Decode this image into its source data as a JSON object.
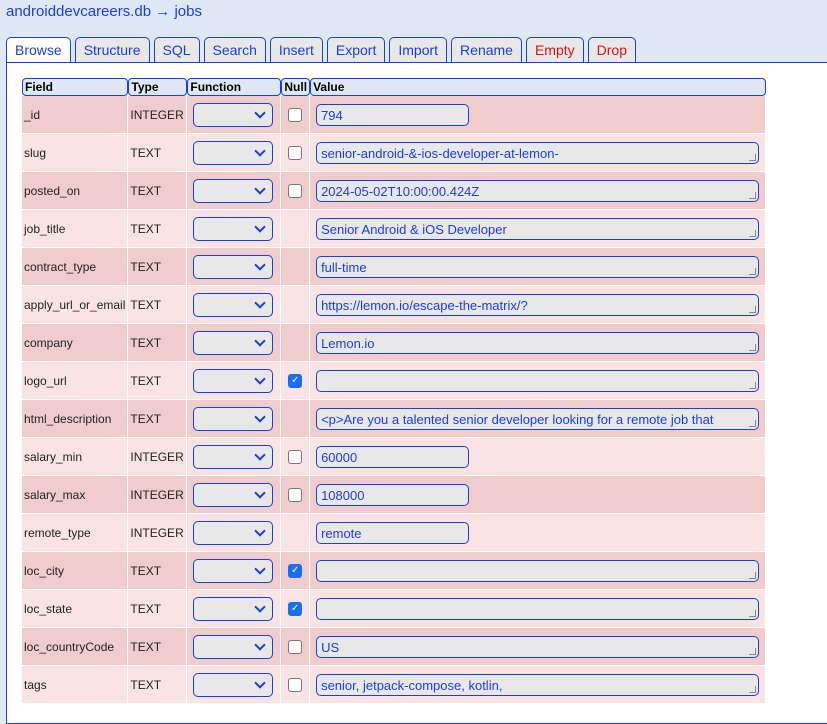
{
  "breadcrumb": {
    "db": "androiddevcareers.db",
    "arrow": "→",
    "table": "jobs"
  },
  "tabs": [
    {
      "label": "Browse",
      "active": true
    },
    {
      "label": "Structure"
    },
    {
      "label": "SQL"
    },
    {
      "label": "Search"
    },
    {
      "label": "Insert"
    },
    {
      "label": "Export"
    },
    {
      "label": "Import"
    },
    {
      "label": "Rename"
    },
    {
      "label": "Empty",
      "danger": true
    },
    {
      "label": "Drop",
      "danger": true
    }
  ],
  "headers": {
    "field": "Field",
    "type": "Type",
    "function": "Function",
    "null": "Null",
    "value": "Value"
  },
  "rows": [
    {
      "field": "_id",
      "type": "INTEGER",
      "nullable": true,
      "null": false,
      "value": "794",
      "kind": "short"
    },
    {
      "field": "slug",
      "type": "TEXT",
      "nullable": true,
      "null": false,
      "value": "senior-android-&-ios-developer-at-lemon-",
      "kind": "long"
    },
    {
      "field": "posted_on",
      "type": "TEXT",
      "nullable": true,
      "null": false,
      "value": "2024-05-02T10:00:00.424Z",
      "kind": "long"
    },
    {
      "field": "job_title",
      "type": "TEXT",
      "nullable": false,
      "value": "Senior Android & iOS Developer",
      "kind": "long"
    },
    {
      "field": "contract_type",
      "type": "TEXT",
      "nullable": false,
      "value": "full-time",
      "kind": "long"
    },
    {
      "field": "apply_url_or_email",
      "type": "TEXT",
      "nullable": false,
      "value": "https://lemon.io/escape-the-matrix/?",
      "kind": "long"
    },
    {
      "field": "company",
      "type": "TEXT",
      "nullable": false,
      "value": "Lemon.io",
      "kind": "long"
    },
    {
      "field": "logo_url",
      "type": "TEXT",
      "nullable": true,
      "null": true,
      "value": "",
      "kind": "long"
    },
    {
      "field": "html_description",
      "type": "TEXT",
      "nullable": false,
      "value": "<p>Are you a talented senior developer looking for a remote job that",
      "kind": "long"
    },
    {
      "field": "salary_min",
      "type": "INTEGER",
      "nullable": true,
      "null": false,
      "value": "60000",
      "kind": "short"
    },
    {
      "field": "salary_max",
      "type": "INTEGER",
      "nullable": true,
      "null": false,
      "value": "108000",
      "kind": "short"
    },
    {
      "field": "remote_type",
      "type": "INTEGER",
      "nullable": false,
      "value": "remote",
      "kind": "short"
    },
    {
      "field": "loc_city",
      "type": "TEXT",
      "nullable": true,
      "null": true,
      "value": "",
      "kind": "long"
    },
    {
      "field": "loc_state",
      "type": "TEXT",
      "nullable": true,
      "null": true,
      "value": "",
      "kind": "long"
    },
    {
      "field": "loc_countryCode",
      "type": "TEXT",
      "nullable": true,
      "null": false,
      "value": "US",
      "kind": "long"
    },
    {
      "field": "tags",
      "type": "TEXT",
      "nullable": true,
      "null": false,
      "value": "senior, jetpack-compose, kotlin,",
      "kind": "long"
    }
  ]
}
